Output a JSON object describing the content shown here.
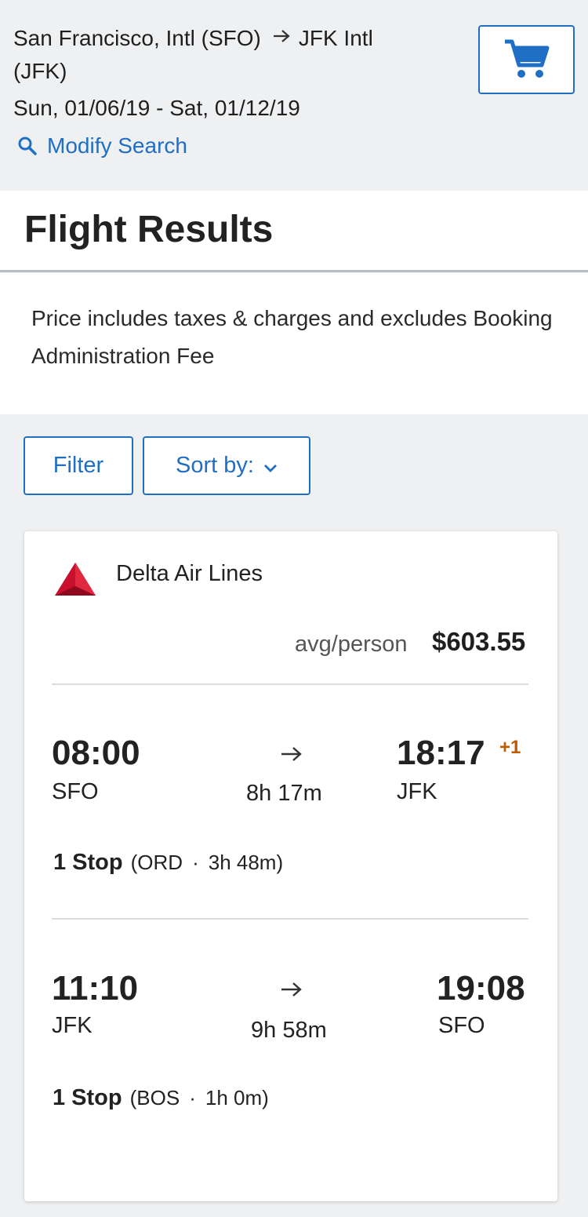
{
  "header": {
    "origin": "San Francisco, Intl (SFO)",
    "destination": "JFK Intl",
    "destination_code_line": "(JFK)",
    "dates": "Sun, 01/06/19 - Sat, 01/12/19",
    "modify_label": "Modify Search",
    "icons": {
      "arrow": "arrow-right-icon",
      "search": "search-icon",
      "cart": "cart-icon"
    }
  },
  "results": {
    "title": "Flight Results",
    "notice": "Price includes taxes & charges and excludes Booking Administration Fee"
  },
  "controls": {
    "filter_label": "Filter",
    "sort_label": "Sort by:"
  },
  "flight": {
    "airline": "Delta Air Lines",
    "avg_label": "avg/person",
    "price": "$603.55",
    "outbound": {
      "depart_time": "08:00",
      "depart_code": "SFO",
      "duration": "8h 17m",
      "arrive_time": "18:17",
      "day_offset": "+1",
      "arrive_code": "JFK",
      "stops_label": "1 Stop",
      "stop_airport": "(ORD",
      "stop_sep": "·",
      "stop_duration": "3h 48m)"
    },
    "return": {
      "depart_time": "11:10",
      "depart_code": "JFK",
      "duration": "9h 58m",
      "arrive_time": "19:08",
      "arrive_code": "SFO",
      "stops_label": "1 Stop",
      "stop_airport": "(BOS",
      "stop_sep": "·",
      "stop_duration": "1h 0m)"
    }
  },
  "colors": {
    "accent": "#1f6fc5",
    "background": "#eff0f2",
    "day_offset": "#c05a00",
    "delta_red": "#c8102e"
  }
}
